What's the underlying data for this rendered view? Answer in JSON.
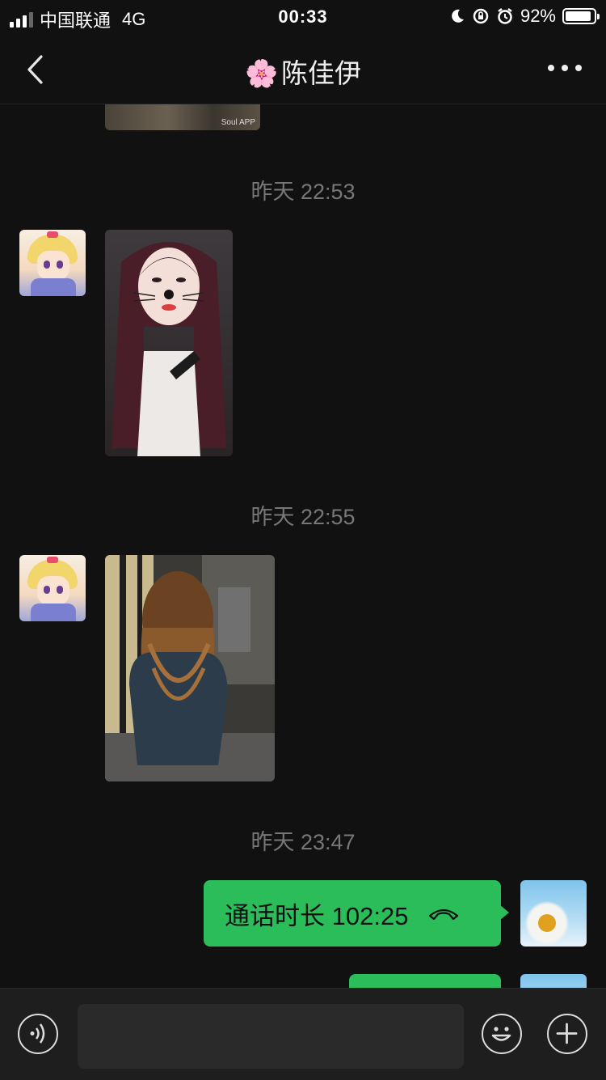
{
  "status_bar": {
    "carrier": "中国联通",
    "network": "4G",
    "time": "00:33",
    "battery_percent": "92%",
    "battery_level": 0.92
  },
  "nav": {
    "title_emoji": "🌸",
    "title": "陈佳伊"
  },
  "chat": {
    "timestamps": [
      "昨天 22:53",
      "昨天 22:55",
      "昨天 23:47"
    ],
    "photo_watermark": "Soul APP",
    "call_bubble_text": "通话时长 102:25"
  },
  "icons": {
    "back": "chevron-left-icon",
    "more": "more-dots-icon",
    "voice": "voice-icon",
    "emoji": "emoji-icon",
    "plus": "plus-icon",
    "phone": "phone-hangup-icon"
  },
  "colors": {
    "background": "#111111",
    "bubble": "#2bbd5a",
    "timestamp": "#777777"
  }
}
